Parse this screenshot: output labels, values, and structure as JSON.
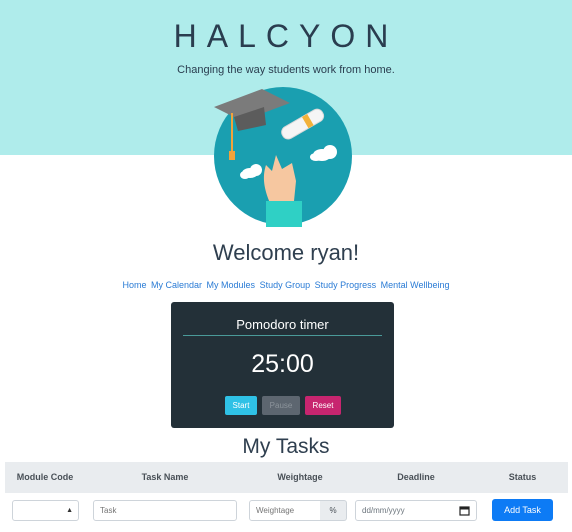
{
  "header": {
    "brand": "HALCYON",
    "tagline": "Changing the way students work from home."
  },
  "welcome": "Welcome ryan!",
  "nav": {
    "items": [
      "Home",
      "My Calendar",
      "My Modules",
      "Study Group",
      "Study Progress",
      "Mental Wellbeing"
    ]
  },
  "timer": {
    "title": "Pomodoro timer",
    "time": "25:00",
    "start_label": "Start",
    "pause_label": "Pause",
    "reset_label": "Reset"
  },
  "tasks": {
    "title": "My Tasks",
    "columns": [
      "Module Code",
      "Task Name",
      "Weightage",
      "Deadline",
      "Status"
    ],
    "task_placeholder": "Task",
    "weightage_placeholder": "Weightage",
    "weightage_unit": "%",
    "deadline_placeholder": "dd/mm/yyyy",
    "add_label": "Add Task"
  },
  "colors": {
    "header_bg": "#afeceb",
    "timer_bg": "#233038",
    "start": "#2fc1e6",
    "reset": "#c7256f",
    "add": "#0d7bf5"
  }
}
